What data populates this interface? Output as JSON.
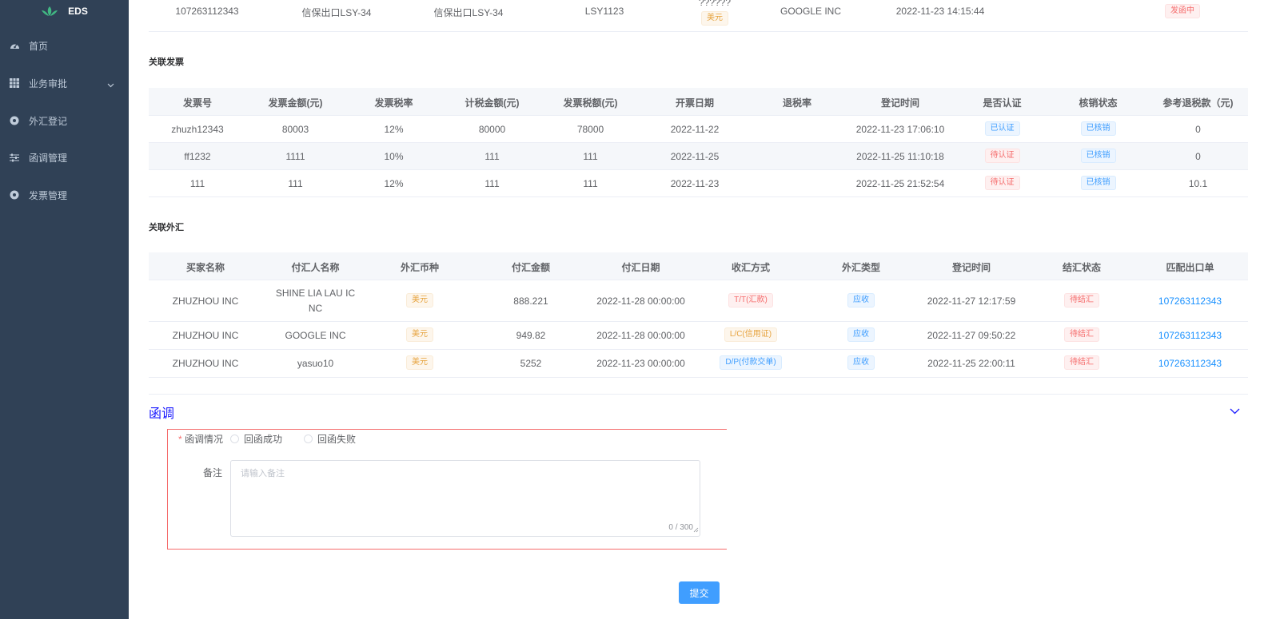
{
  "app": {
    "logo_text": "EDS"
  },
  "sidebar": {
    "items": [
      {
        "label": "首页",
        "icon": "dashboard-icon"
      },
      {
        "label": "业务审批",
        "icon": "grid-icon",
        "has_submenu": true
      },
      {
        "label": "外汇登记",
        "icon": "circle-icon"
      },
      {
        "label": "函调管理",
        "icon": "sliders-icon"
      },
      {
        "label": "发票管理",
        "icon": "circle-icon"
      }
    ]
  },
  "top_row": {
    "col1": "107263112343",
    "col2": "信保出口LSY-34",
    "col3": "信保出口LSY-34",
    "col4": "LSY1123",
    "col5_top": "??????",
    "col5_tag": "美元",
    "col6": "GOOGLE INC",
    "col7": "2022-11-23 14:15:44",
    "status_tag": "发函中"
  },
  "invoices": {
    "title": "关联发票",
    "headers": [
      "发票号",
      "发票金额(元)",
      "发票税率",
      "计税金额(元)",
      "发票税额(元)",
      "开票日期",
      "退税率",
      "登记时间",
      "是否认证",
      "核销状态",
      "参考退税款（元)"
    ],
    "rows": [
      {
        "no": "zhuzh12343",
        "amount": "80003",
        "rate": "12%",
        "taxable": "80000",
        "tax": "78000",
        "date": "2022-11-22",
        "refund_rate": "",
        "reg_time": "2022-11-23 17:06:10",
        "certified": "已认证",
        "certified_style": "blue",
        "writeoff": "已核销",
        "refund": "0"
      },
      {
        "no": "ff1232",
        "amount": "1111",
        "rate": "10%",
        "taxable": "111",
        "tax": "111",
        "date": "2022-11-25",
        "refund_rate": "",
        "reg_time": "2022-11-25 11:10:18",
        "certified": "待认证",
        "certified_style": "red",
        "writeoff": "已核销",
        "refund": "0"
      },
      {
        "no": "111",
        "amount": "111",
        "rate": "12%",
        "taxable": "111",
        "tax": "111",
        "date": "2022-11-23",
        "refund_rate": "",
        "reg_time": "2022-11-25 21:52:54",
        "certified": "待认证",
        "certified_style": "red",
        "writeoff": "已核销",
        "refund": "10.1"
      }
    ]
  },
  "forex": {
    "title": "关联外汇",
    "headers": [
      "买家名称",
      "付汇人名称",
      "外汇币种",
      "付汇金额",
      "付汇日期",
      "收汇方式",
      "外汇类型",
      "登记时间",
      "结汇状态",
      "匹配出口单"
    ],
    "rows": [
      {
        "buyer": "ZHUZHOU INC",
        "payer_line1": "SHINE LIA LAU IC",
        "payer_line2": "NC",
        "currency": "美元",
        "amount": "888.221",
        "date": "2022-11-28 00:00:00",
        "method": "T/T(汇款)",
        "method_style": "red",
        "type": "应收",
        "reg_time": "2022-11-27 12:17:59",
        "settle": "待结汇",
        "order": "107263112343"
      },
      {
        "buyer": "ZHUZHOU INC",
        "payer_line1": "GOOGLE INC",
        "payer_line2": "",
        "currency": "美元",
        "amount": "949.82",
        "date": "2022-11-28 00:00:00",
        "method": "L/C(信用证)",
        "method_style": "orange",
        "type": "应收",
        "reg_time": "2022-11-27 09:50:22",
        "settle": "待结汇",
        "order": "107263112343"
      },
      {
        "buyer": "ZHUZHOU INC",
        "payer_line1": "yasuo10",
        "payer_line2": "",
        "currency": "美元",
        "amount": "5252",
        "date": "2022-11-23 00:00:00",
        "method": "D/P(付款交单)",
        "method_style": "blue",
        "type": "应收",
        "reg_time": "2022-11-25 22:00:11",
        "settle": "待结汇",
        "order": "107263112343"
      }
    ]
  },
  "letter": {
    "title": "函调",
    "status_label": "函调情况",
    "required_mark": "*",
    "options": [
      "回函成功",
      "回函失败"
    ],
    "remark_label": "备注",
    "remark_placeholder": "请输入备注",
    "remark_count": "0 / 300",
    "submit_label": "提交"
  },
  "colors": {
    "sidebar_bg": "#304156",
    "primary": "#409eff",
    "danger": "#f56c6c",
    "warning": "#e6a23c"
  }
}
